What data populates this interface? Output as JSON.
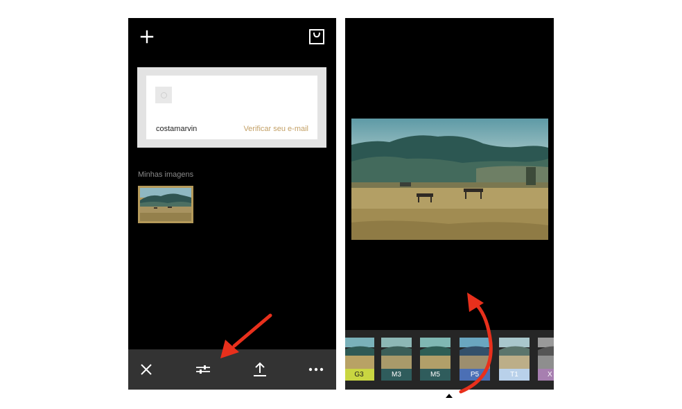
{
  "left_screen": {
    "profile": {
      "username": "costamarvin",
      "verify_email": "Verificar seu e-mail"
    },
    "gallery": {
      "section_title": "Minhas imagens"
    },
    "toolbar": {
      "close_icon": "close-icon",
      "adjust_icon": "sliders-icon",
      "export_icon": "upload-icon",
      "more_icon": "more-horizontal-icon"
    },
    "top_icons": [
      "add-icon",
      "shopping-bag-icon"
    ]
  },
  "right_screen": {
    "filters": [
      {
        "label": "G3",
        "color": "#c9d641",
        "label_text_color": "#1a1a1a"
      },
      {
        "label": "M3",
        "color": "#2f5c5c",
        "label_text_color": "#ffffff"
      },
      {
        "label": "M5",
        "color": "#2f5c5c",
        "label_text_color": "#ffffff"
      },
      {
        "label": "P5",
        "color": "#4b6fb5",
        "label_text_color": "#ffffff"
      },
      {
        "label": "T1",
        "color": "#b9d1ea",
        "label_text_color": "#ffffff"
      },
      {
        "label": "X",
        "color": "#a77fb0",
        "label_text_color": "#ffffff"
      }
    ]
  },
  "colors": {
    "accent_gold": "#c3a066",
    "annotation_red": "#e8301c",
    "toolbar_bg": "#333333",
    "filter_strip_bg": "#262626"
  }
}
